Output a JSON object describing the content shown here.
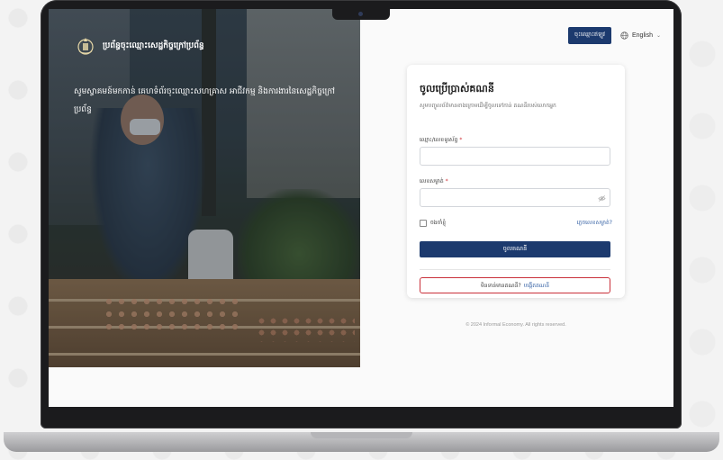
{
  "window": {
    "title": "ចូលប្រើប្រាស់គណនី"
  },
  "brand": {
    "name": "ប្រព័ន្ធចុះឈ្មោះសេដ្ឋកិច្ចក្រៅប្រព័ន្ធ",
    "seal_icon": "royal-seal-icon"
  },
  "hero": {
    "tagline": "សូមស្វាគមន៍មកកាន់ គេហទំព័រចុះឈ្មោះសហគ្រាស អាជីវកម្ម និងការងារនៃសេដ្ឋកិច្ចក្រៅប្រព័ន្ធ"
  },
  "topbar": {
    "register_label": "ចុះឈ្មោះឥឡូវ",
    "language": "English"
  },
  "login": {
    "title": "ចូលប្រើប្រាស់គណនី",
    "subtitle": "សូមបញ្ចូលព័ត៌មានខាងក្រោមដើម្បីចូលទៅកាន់ គណនីរបស់លោកអ្នក",
    "username_label": "ឈ្មោះ/លេខទូរស័ព្ទ",
    "username_value": "",
    "password_label": "លេខសម្ងាត់",
    "password_value": "",
    "required_mark": "*",
    "remember_label": "ចងចាំខ្ញុំ",
    "forgot_label": "ភ្លេចលេខសម្ងាត់?",
    "submit_label": "ចូលគណនី",
    "no_account_text": "មិនទាន់មានគណនី?",
    "create_account_label": "បង្កើតគណនី"
  },
  "footer": {
    "copyright": "© 2024 Informal Economy. All rights reserved."
  },
  "colors": {
    "primary": "#1c3a6e",
    "danger_border": "#c9303a",
    "link": "#2c5aa0"
  }
}
